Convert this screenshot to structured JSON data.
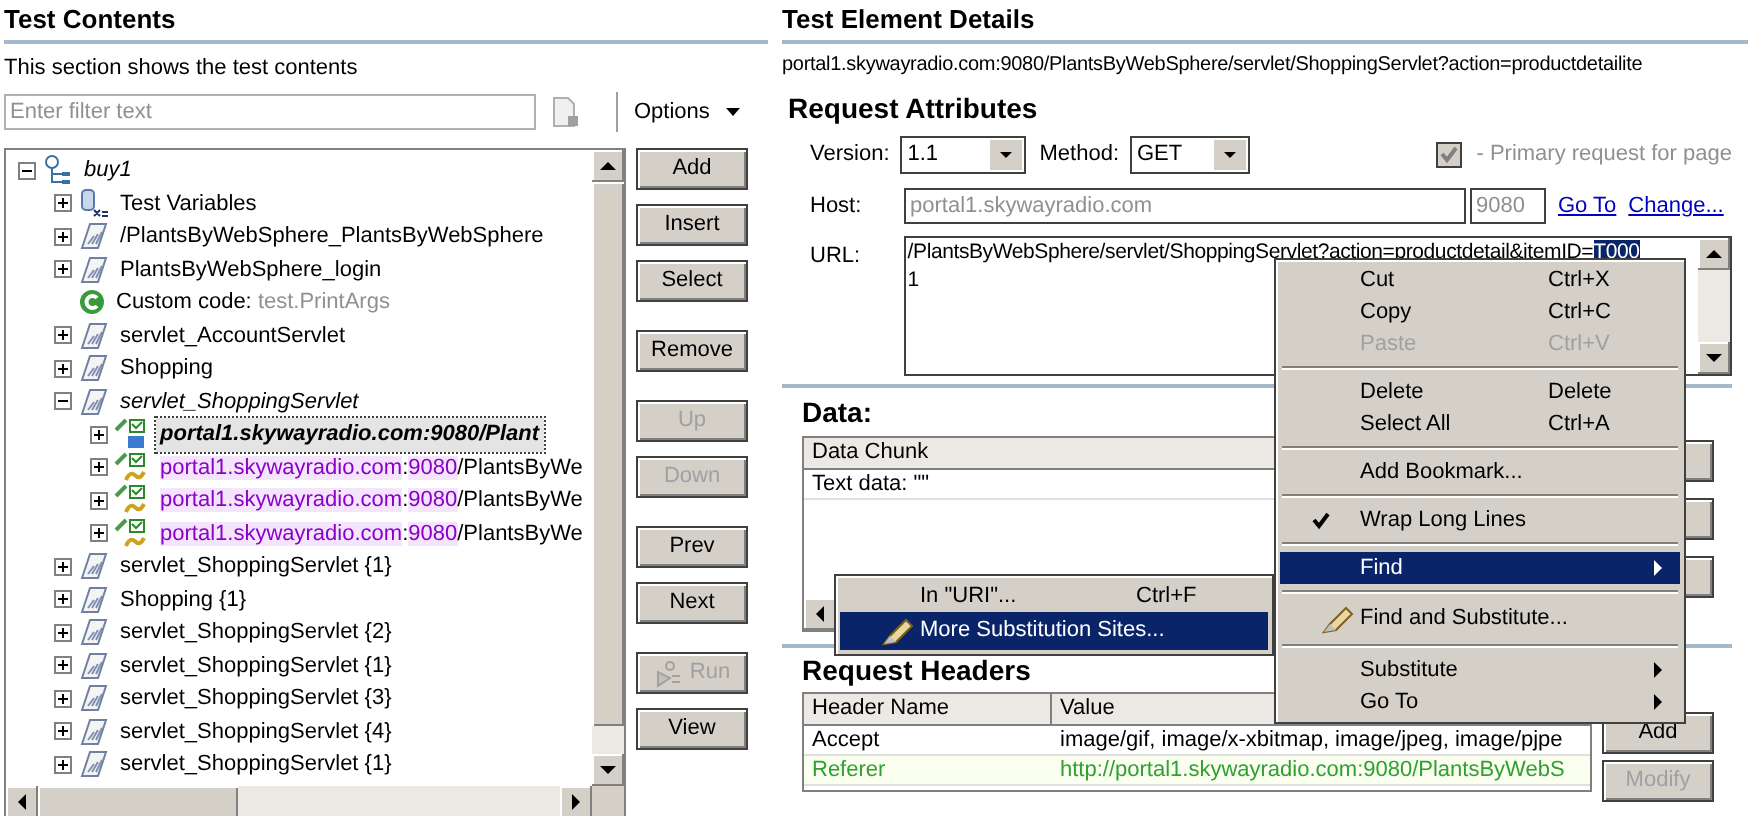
{
  "left": {
    "title": "Test Contents",
    "description": "This section shows the test contents",
    "filter": {
      "placeholder": "Enter filter text"
    },
    "options": "Options",
    "tree": [
      {
        "kind": "test",
        "label": "buy1",
        "italic": true,
        "expanded": true,
        "selected": false,
        "children": [
          {
            "kind": "variables",
            "label": "Test Variables",
            "expanded": false,
            "selected": false
          },
          {
            "kind": "page",
            "label": "/PlantsByWebSphere_PlantsByWebSphere",
            "expanded": false,
            "selected": false
          },
          {
            "kind": "page",
            "label": "PlantsByWebSphere_login",
            "expanded": false,
            "selected": false
          },
          {
            "kind": "custom",
            "label": "Custom code:",
            "value": "test.PrintArgs",
            "selected": false
          },
          {
            "kind": "page",
            "label": "servlet_AccountServlet",
            "expanded": false,
            "selected": false
          },
          {
            "kind": "page",
            "label": "Shopping",
            "expanded": false,
            "selected": false
          },
          {
            "kind": "page",
            "label": "servlet_ShoppingServlet",
            "italic": true,
            "expanded": true,
            "selected": false,
            "children": [
              {
                "kind": "request",
                "primary": true,
                "expanded": false,
                "selected": true,
                "segments": [
                  {
                    "text": "portal1.skywayradio.com:9080/Plant",
                    "highlight": false
                  }
                ]
              },
              {
                "kind": "request",
                "primary": false,
                "expanded": false,
                "selected": false,
                "segments": [
                  {
                    "text": "portal1.skywayradio.com",
                    "highlight": true
                  },
                  {
                    "text": ":",
                    "highlight": false
                  },
                  {
                    "text": "9080",
                    "highlight": true
                  },
                  {
                    "text": "/PlantsByWe",
                    "highlight": false
                  }
                ]
              },
              {
                "kind": "request",
                "primary": false,
                "expanded": false,
                "selected": false,
                "segments": [
                  {
                    "text": "portal1.skywayradio.com",
                    "highlight": true
                  },
                  {
                    "text": ":",
                    "highlight": false
                  },
                  {
                    "text": "9080",
                    "highlight": true
                  },
                  {
                    "text": "/PlantsByWe",
                    "highlight": false
                  }
                ]
              },
              {
                "kind": "request",
                "primary": false,
                "expanded": false,
                "selected": false,
                "segments": [
                  {
                    "text": "portal1.skywayradio.com",
                    "highlight": true
                  },
                  {
                    "text": ":",
                    "highlight": false
                  },
                  {
                    "text": "9080",
                    "highlight": true
                  },
                  {
                    "text": "/PlantsByWe",
                    "highlight": false
                  }
                ]
              }
            ]
          },
          {
            "kind": "page",
            "label": "servlet_ShoppingServlet {1}",
            "expanded": false,
            "selected": false
          },
          {
            "kind": "page",
            "label": "Shopping {1}",
            "expanded": false,
            "selected": false
          },
          {
            "kind": "page",
            "label": "servlet_ShoppingServlet {2}",
            "expanded": false,
            "selected": false
          },
          {
            "kind": "page",
            "label": "servlet_ShoppingServlet {1}",
            "expanded": false,
            "selected": false
          },
          {
            "kind": "page",
            "label": "servlet_ShoppingServlet {3}",
            "expanded": false,
            "selected": false
          },
          {
            "kind": "page",
            "label": "servlet_ShoppingServlet {4}",
            "expanded": false,
            "selected": false
          },
          {
            "kind": "page",
            "label": "servlet_ShoppingServlet {1}",
            "expanded": false,
            "selected": false
          }
        ]
      }
    ],
    "button_groups": [
      [
        {
          "label": "Add",
          "disabled": false
        },
        {
          "label": "Insert",
          "disabled": false
        },
        {
          "label": "Select",
          "disabled": false
        }
      ],
      [
        {
          "label": "Remove",
          "disabled": false
        }
      ],
      [
        {
          "label": "Up",
          "disabled": true
        },
        {
          "label": "Down",
          "disabled": true
        }
      ],
      [
        {
          "label": "Prev",
          "disabled": false
        },
        {
          "label": "Next",
          "disabled": false
        }
      ],
      [
        {
          "label": "Run",
          "disabled": true,
          "icon": true
        },
        {
          "label": "View",
          "disabled": false
        }
      ]
    ]
  },
  "details": {
    "title": "Test Element Details",
    "address": "portal1.skywayradio.com:9080/PlantsByWebSphere/servlet/ShoppingServlet?action=productdetailite",
    "attributes": {
      "title": "Request Attributes",
      "version_label": "Version:",
      "version": "1.1",
      "method_label": "Method:",
      "method": "GET",
      "primary": {
        "label": "- Primary request for page",
        "checked": true,
        "disabled": true
      },
      "host_label": "Host:",
      "host": "portal1.skywayradio.com",
      "port": "9080",
      "links": [
        "Go To",
        "Change..."
      ],
      "url_label": "URL:",
      "url": {
        "before": "/PlantsByWebSphere/servlet/ShoppingServlet?action=productdetail&itemID=",
        "selected": "T000",
        "after": "1"
      }
    },
    "data": {
      "title": "Data:",
      "column": "Data Chunk",
      "rows": [
        "Text data: \"\""
      ]
    },
    "headers": {
      "title": "Request Headers",
      "columns": [
        "Header Name",
        "Value"
      ],
      "rows": [
        {
          "name": "Accept",
          "value": "image/gif, image/x-xbitmap, image/jpeg, image/pjpe",
          "substituted": false
        },
        {
          "name": "Referer",
          "value": "http://portal1.skywayradio.com:9080/PlantsByWebS",
          "substituted": true
        }
      ],
      "buttons": [
        {
          "label": "Add",
          "disabled": false
        },
        {
          "label": "Modify",
          "disabled": true
        }
      ]
    }
  },
  "context_menu": {
    "items": [
      {
        "kind": "item",
        "label": "Cut",
        "shortcut": "Ctrl+X",
        "disabled": false
      },
      {
        "kind": "item",
        "label": "Copy",
        "shortcut": "Ctrl+C",
        "disabled": false
      },
      {
        "kind": "item",
        "label": "Paste",
        "shortcut": "Ctrl+V",
        "disabled": true
      },
      {
        "kind": "separator"
      },
      {
        "kind": "item",
        "label": "Delete",
        "shortcut": "Delete",
        "disabled": false
      },
      {
        "kind": "item",
        "label": "Select All",
        "shortcut": "Ctrl+A",
        "disabled": false
      },
      {
        "kind": "separator"
      },
      {
        "kind": "item",
        "label": "Add Bookmark...",
        "disabled": false
      },
      {
        "kind": "separator"
      },
      {
        "kind": "check",
        "label": "Wrap Long Lines",
        "checked": true
      },
      {
        "kind": "separator"
      },
      {
        "kind": "submenu",
        "label": "Find",
        "selected": true
      },
      {
        "kind": "separator"
      },
      {
        "kind": "icon_item",
        "label": "Find and Substitute...",
        "selected": false
      },
      {
        "kind": "separator"
      },
      {
        "kind": "submenu",
        "label": "Substitute",
        "selected": false
      },
      {
        "kind": "submenu",
        "label": "Go To",
        "selected": false
      }
    ]
  },
  "submenu": {
    "items": [
      {
        "kind": "item",
        "label": "In \"URI\"...",
        "shortcut": "Ctrl+F",
        "selected": false
      },
      {
        "kind": "icon_item",
        "label": "More Substitution Sites...",
        "selected": true
      }
    ]
  }
}
